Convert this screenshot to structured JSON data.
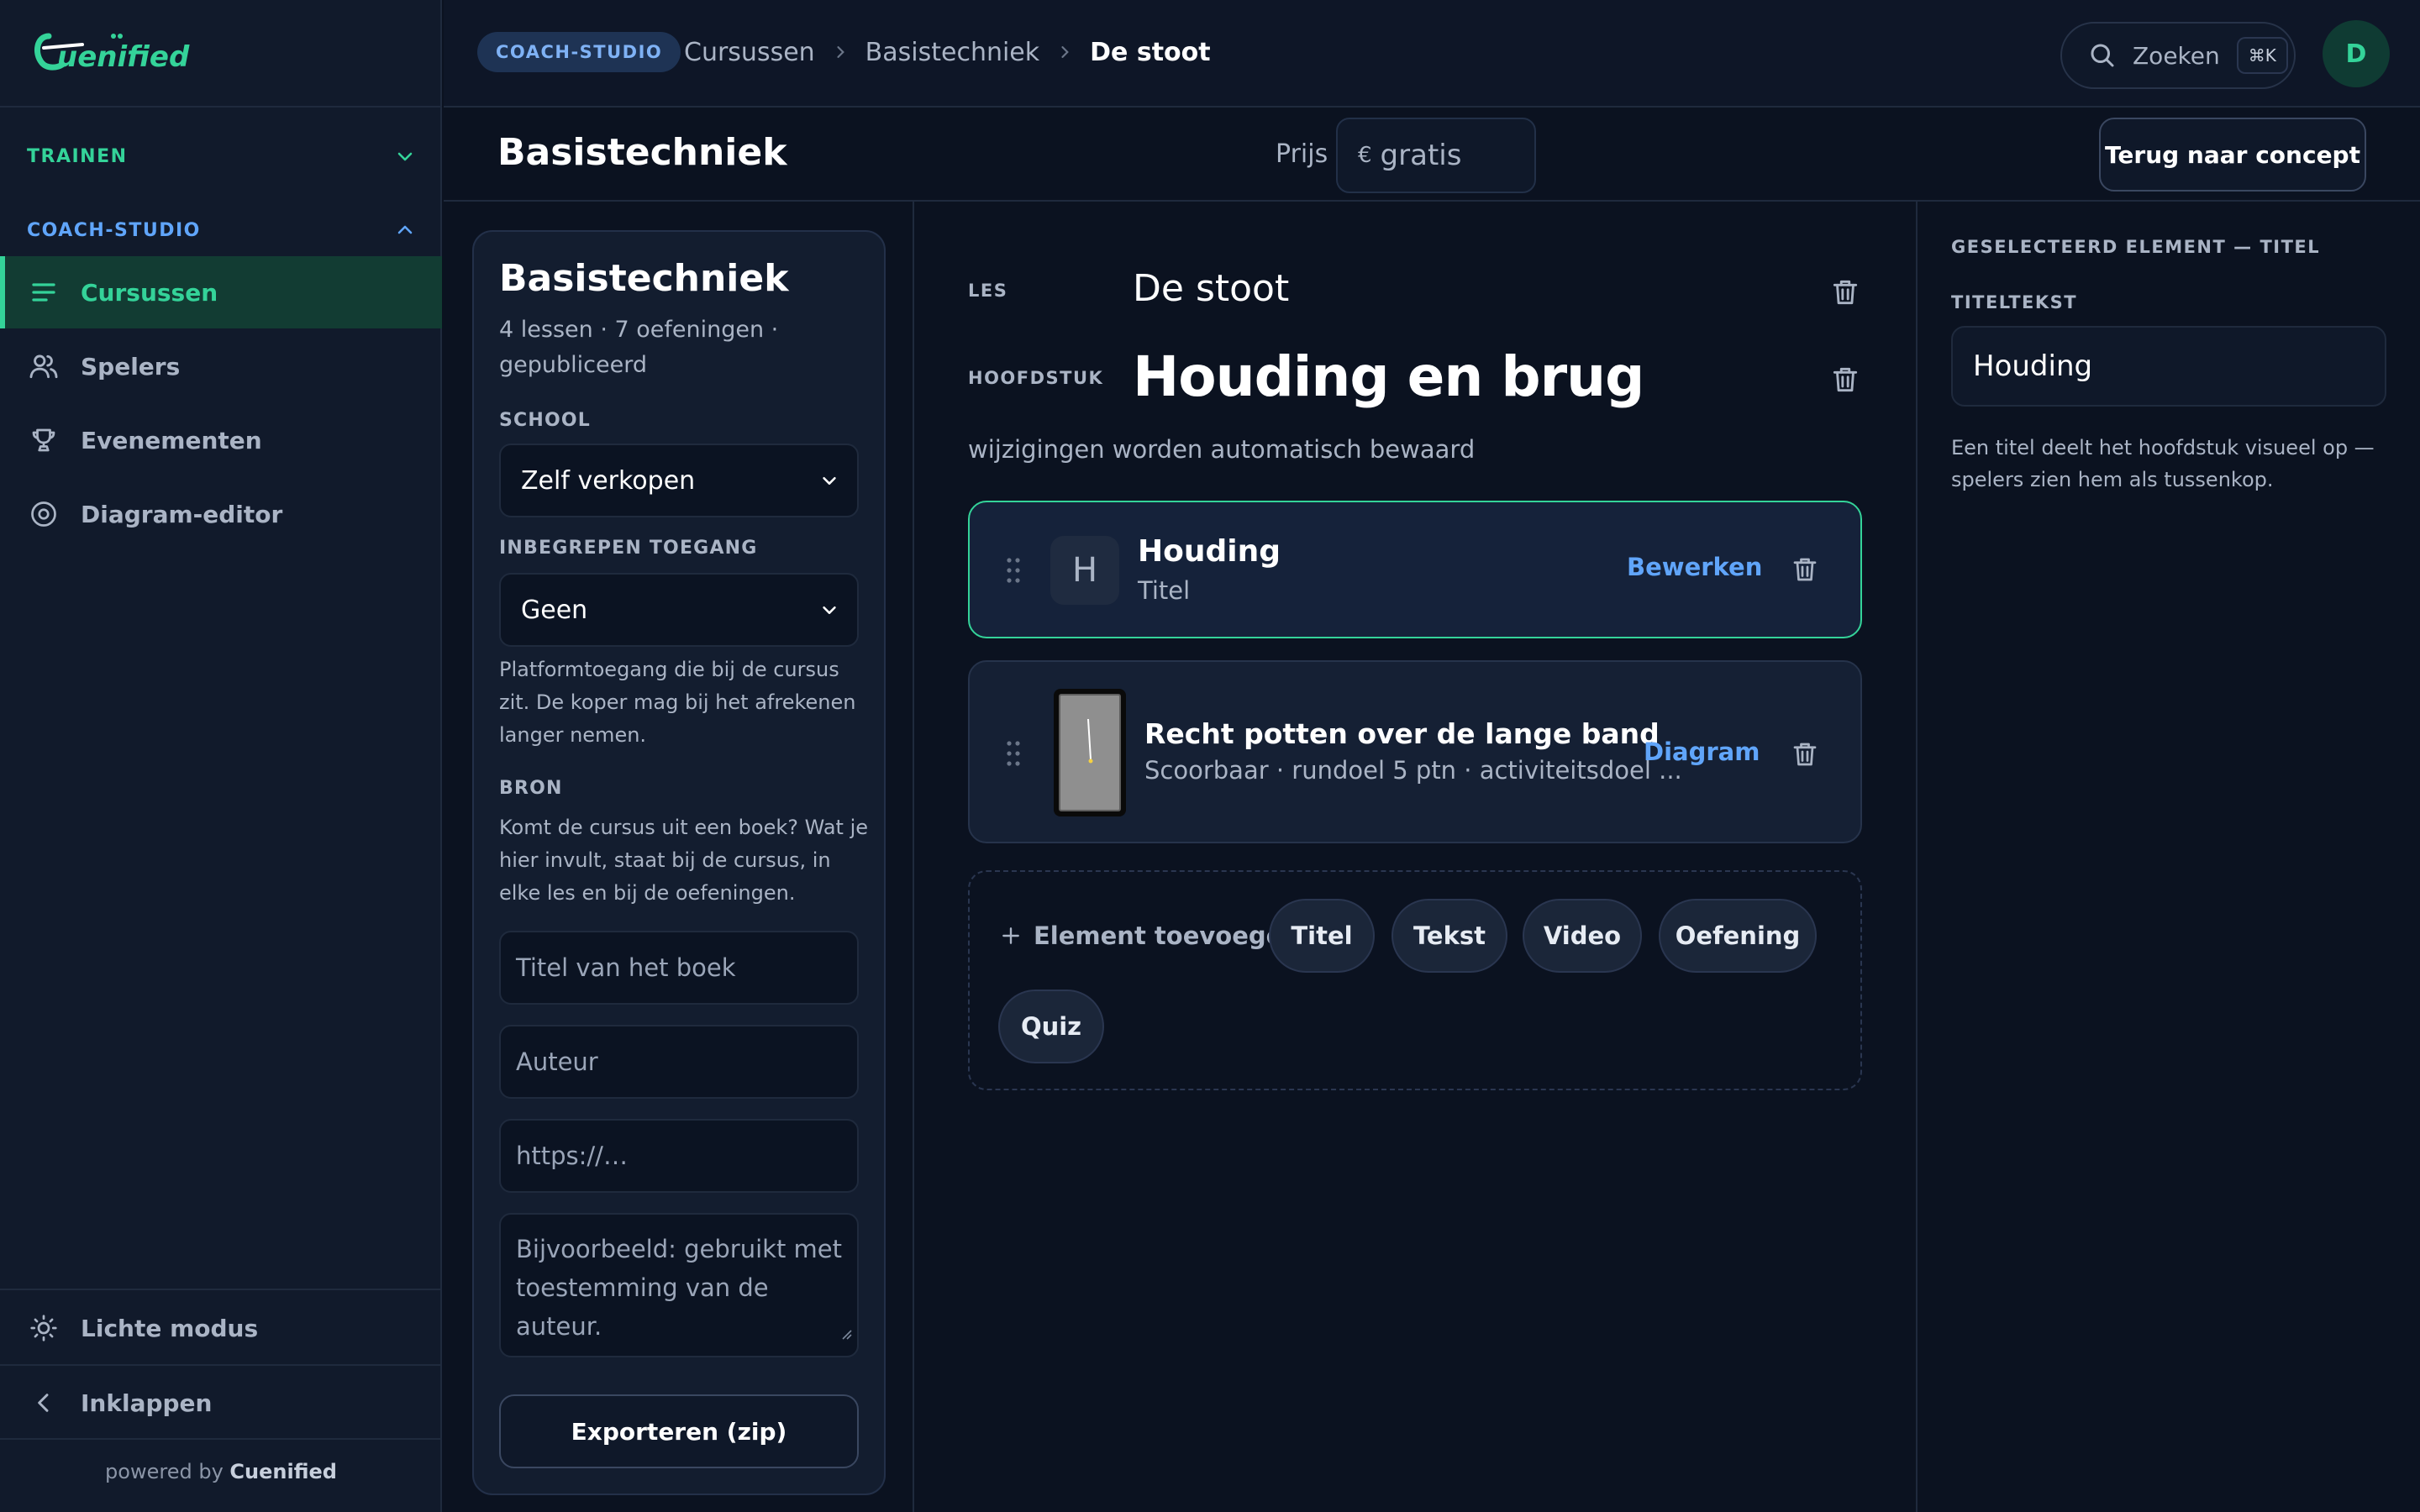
{
  "brand": {
    "logo_text": "Cuenified",
    "accent": "#34d399",
    "blue": "#60a5fa"
  },
  "sidebar": {
    "sections": [
      {
        "label": "TRAINEN",
        "expanded": false
      },
      {
        "label": "COACH-STUDIO",
        "expanded": true
      }
    ],
    "items": [
      {
        "label": "Cursussen",
        "icon": "list-icon",
        "active": true
      },
      {
        "label": "Spelers",
        "icon": "users-icon",
        "active": false
      },
      {
        "label": "Evenementen",
        "icon": "trophy-icon",
        "active": false
      },
      {
        "label": "Diagram-editor",
        "icon": "target-icon",
        "active": false
      }
    ],
    "light_mode": "Lichte modus",
    "collapse": "Inklappen",
    "powered_prefix": "powered by",
    "powered_brand": "Cuenified"
  },
  "topbar": {
    "badge": "COACH-STUDIO",
    "breadcrumb": [
      "Cursussen",
      "Basistechniek",
      "De stoot"
    ],
    "search_label": "Zoeken",
    "search_shortcut": "⌘K",
    "avatar_initial": "D"
  },
  "title_row": {
    "title": "Basistechniek",
    "price_label": "Prijs",
    "price_currency": "€",
    "price_placeholder": "gratis",
    "back_button": "Terug naar concept"
  },
  "course": {
    "title": "Basistechniek",
    "meta": "4 lessen · 7 oefeningen · gepubliceerd",
    "school_label": "SCHOOL",
    "school_value": "Zelf verkopen",
    "access_label": "INBEGREPEN TOEGANG",
    "access_value": "Geen",
    "access_help": "Platformtoegang die bij de cursus zit. De koper mag bij het afrekenen langer nemen.",
    "source_label": "BRON",
    "source_help": "Komt de cursus uit een boek? Wat je hier invult, staat bij de cursus, in elke les en bij de oefeningen.",
    "book_title_placeholder": "Titel van het boek",
    "author_placeholder": "Auteur",
    "url_placeholder": "https://…",
    "note_placeholder": "Bijvoorbeeld: gebruikt met toestemming van de auteur.",
    "export_button": "Exporteren (zip)"
  },
  "editor": {
    "les_label": "LES",
    "les_title": "De stoot",
    "chapter_label": "HOOFDSTUK",
    "chapter_title": "Houding en brug",
    "autosave": "wijzigingen worden automatisch bewaard",
    "blocks": [
      {
        "thumb": "H",
        "name": "Houding",
        "sub": "Titel",
        "action": "Bewerken",
        "selected": true
      },
      {
        "name": "Recht potten over de lange band",
        "sub": "Scoorbaar · rundoel 5 ptn · activiteitsdoel ...",
        "action": "Diagram",
        "selected": false
      }
    ],
    "add_label": "Element toevoegen",
    "chips": [
      "Titel",
      "Tekst",
      "Video",
      "Oefening",
      "Quiz"
    ]
  },
  "inspector": {
    "header": "GESELECTEERD ELEMENT — TITEL",
    "field_label": "TITELTEKST",
    "field_value": "Houding",
    "help": "Een titel deelt het hoofdstuk visueel op — spelers zien hem als tussenkop."
  }
}
